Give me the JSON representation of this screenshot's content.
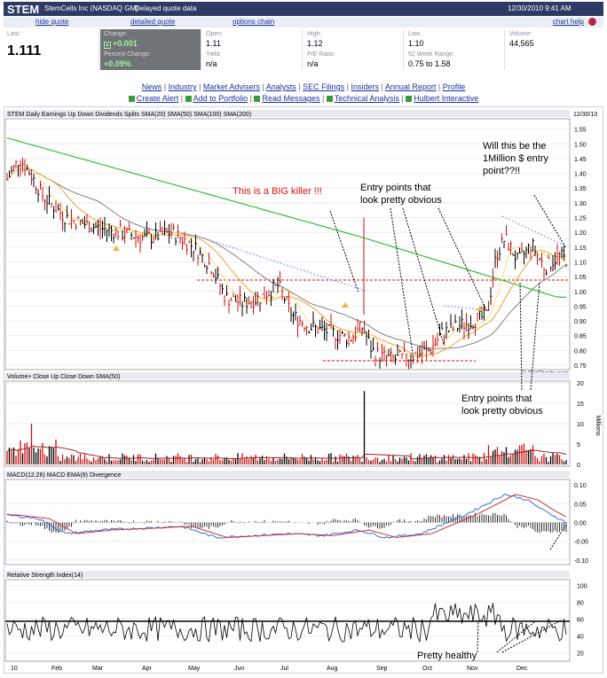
{
  "header": {
    "symbol": "STEM",
    "company": "StemCells Inc (NASDAQ GM)",
    "delayed": "Delayed quote data",
    "datetime": "12/30/2010 9:41 AM"
  },
  "links_row": {
    "hide_quote": "hide quote",
    "detailed_quote": "detailed quote",
    "options_chain": "options chain",
    "chart_help": "chart help",
    "help_icon": "?"
  },
  "quote": {
    "last_label": "Last:",
    "last": "1.111",
    "change_label": "Change:",
    "change": "+0.001",
    "pct_label": "Percent Change:",
    "pct": "+0.09%",
    "open_label": "Open:",
    "open": "1.11",
    "high_label": "High:",
    "high": "1.12",
    "low_label": "Low:",
    "low": "1.10",
    "volume_label": "Volume:",
    "volume": "44,565",
    "yield_label": "Yield:",
    "yield": "n/a",
    "pe_label": "P/E Ratio:",
    "pe": "n/a",
    "range_label": "52 Week Range:",
    "range": "0.75 to 1.58"
  },
  "nav": {
    "row1": [
      "News",
      "Industry",
      "Market Advisers",
      "Analysts",
      "SEC Filings",
      "Insiders",
      "Annual Report",
      "Profile"
    ],
    "row2": [
      "Create Alert",
      "Add to Portfolio",
      "Read Messages",
      "Technical Analysis",
      "Hulbert Interactive"
    ]
  },
  "colors": {
    "header_bg": "#2d3a63",
    "sma20": "#e04040",
    "sma50": "#f0a030",
    "sma100": "#808080",
    "sma200": "#30c030",
    "up": "#000000",
    "down": "#d01010"
  },
  "price_panel": {
    "legend": "STEM Daily    Earnings Up  Down  Dividends  Splits  SMA(20)  SMA(50)  SMA(100)  SMA(200)",
    "date": "12/30/10",
    "watermark": "© BigCharts.com",
    "y_ticks": [
      "1.55",
      "1.50",
      "1.45",
      "1.40",
      "1.35",
      "1.30",
      "1.25",
      "1.20",
      "1.15",
      "1.10",
      "1.05",
      "1.00",
      "0.95",
      "0.90",
      "0.85",
      "0.80",
      "0.75"
    ]
  },
  "volume_panel": {
    "legend": "Volume+  Close Up  Close Down  SMA(50)",
    "y_ticks": [
      "20",
      "15",
      "10",
      "5",
      "0"
    ],
    "unit": "Millions"
  },
  "macd_panel": {
    "legend": "MACD(12,26)  MACD EMA(9)  Divergence",
    "y_ticks": [
      "0.10",
      "0.05",
      "0.00",
      "-0.05",
      "-0.10"
    ]
  },
  "rsi_panel": {
    "legend": "Relative Strength Index(14)",
    "y_ticks": [
      "100",
      "80",
      "60",
      "40",
      "20"
    ],
    "levels": [
      70,
      50
    ]
  },
  "x_labels": [
    "10",
    "Feb",
    "Mar",
    "Apr",
    "May",
    "Jun",
    "Jul",
    "Aug",
    "Sep",
    "Oct",
    "Nov",
    "Dec"
  ],
  "annotations": {
    "big_killer": "This is a BIG killer !!!",
    "entry_top": "Entry points that\nlook pretty obvious",
    "million": "Will this be the\n1Million $ entry\npoint??!!",
    "entry_bottom": "Entry points that\nlook pretty obvious",
    "healthy": "Pretty healthy"
  }
}
